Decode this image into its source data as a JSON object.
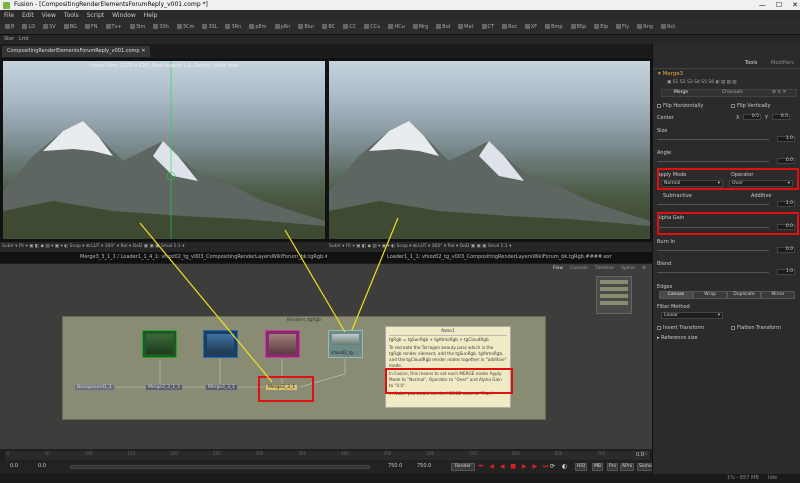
{
  "window": {
    "title": "Fusion - [CompositingRenderElementsForumReply_v001.comp *]",
    "controls": [
      "—",
      "☐",
      "✕"
    ]
  },
  "menu": [
    "File",
    "Edit",
    "View",
    "Tools",
    "Script",
    "Window",
    "Help"
  ],
  "toolbar": [
    "B",
    "LD",
    "SV",
    "BG",
    "FN",
    "Tx+",
    "3Im",
    "3Sh",
    "3Cm",
    "3SL",
    "3Rn",
    "pEm",
    "pRn",
    "Blur",
    "BC",
    "CC",
    "CCu",
    "HCu",
    "Mrg",
    "Bol",
    "Mat",
    "CT",
    "Rsz",
    "XF",
    "Bmp",
    "BSp",
    "Elp",
    "Fly",
    "Rng",
    "Rct"
  ],
  "toolbar2": [
    "Star",
    "Lmt"
  ],
  "comp_tab": "CompositingRenderElementsForumReply_v001.comp",
  "viewer_left": {
    "info": "Frame Size: 1103 x 620, Pixel Aspect 1:1, Depth: 16bit float",
    "toolbar": "SubV ▾  Fit ▾  ▣ ◧  ◆  ▤  ▾ ▣ ▾ ◐ Snap ▾  ⊞  LUT ▾  360° ▾ RoI ▾ DoD  ▣ ▣ ▣ Smal 1:1 ▾",
    "label": "Merge3_3_1_1 / Loader1_1_4_1: vfxoz02_tg_v003_CompositingRenderLayersWikiForum_bk.tgRgb.####.exr"
  },
  "viewer_right": {
    "toolbar": "SubV ▾  Fit ▾  ▣ ◧  ◆  ▤  ▾ ▣ ▾ ◐ Snap ▾  ⊞  LUT ▾  360° ▾ RoI ▾ DoD  ▣ ▣ ▣ Smal 1:1 ▾",
    "label": "Loader1_1_1: vfxoz02_tg_v003_CompositingRenderLayersWikiForum_bk.tgRgb.####.exr"
  },
  "flow": {
    "tabs": [
      "Flow",
      "Console",
      "Timeline",
      "Spline"
    ],
    "group_title": "Renders_tgRgb",
    "nodes": [
      {
        "label": "Background1_1",
        "color": "#6b6f78"
      },
      {
        "label": "Merge3_3_1_1",
        "color": "#5a5f68"
      },
      {
        "label": "Merge3_3_1",
        "color": "#5a5f68"
      },
      {
        "label": "Merge3_3_1",
        "color": "#5a5f68"
      }
    ],
    "loader_label": "vfxoz02_tg...",
    "note": {
      "title": "Note1",
      "lines": [
        "tgRgb = tgSunRgb + tgAtmoRgb + tgCloudRgb",
        "To recreate the Terragen beauty pass which is the tgRgb render element, add the tgSunRgb, tgAtmoRgb, and the tgCloudRgb render nodes together in \"additive\" mode.",
        "In Fusion, this means to set each MERGE nodes Apply Mode to \"Normal\", Operator to \"Over\" and Alpha Gain to \"0.0\".",
        "In Nuke, you would set the MERGE node to \"Plus\"."
      ]
    }
  },
  "timeline": {
    "ticks": [
      "0",
      "50",
      "100",
      "150",
      "200",
      "250",
      "300",
      "350",
      "400",
      "450",
      "500",
      "550",
      "600",
      "650",
      "700",
      "750"
    ],
    "start": "0.0",
    "render_start": "0.0",
    "render_end": "750.0",
    "end": "750.0",
    "end_right": "0.0",
    "render_btn": "Render",
    "buttons": [
      "HiQ",
      "MB",
      "Prx",
      "APrx",
      "Some"
    ]
  },
  "status": {
    "memory": "1% - 857 MB",
    "state": "Idle"
  },
  "inspector": {
    "tabs": [
      "Tools",
      "Modifiers"
    ],
    "node_name": "Merge3",
    "subtabs": [
      "Merge",
      "Channels"
    ],
    "flip_h": "Flip Horizontally",
    "flip_v": "Flip Vertically",
    "center_label": "Center",
    "center_x": "0.5",
    "center_y": "0.5",
    "size_label": "Size",
    "size_value": "1.0",
    "angle_label": "Angle",
    "angle_value": "0.0",
    "apply_mode_label": "Apply Mode",
    "apply_mode_value": "Normal",
    "operator_label": "Operator",
    "operator_value": "Over",
    "subtractive_label": "Subtractive",
    "additive_label": "Additive",
    "additive_value": "1.0",
    "alpha_gain_label": "Alpha Gain",
    "alpha_gain_value": "0.0",
    "burn_in_label": "Burn In",
    "burn_in_value": "0.0",
    "blend_label": "Blend",
    "blend_value": "1.0",
    "edges_label": "Edges",
    "edges_options": [
      "Canvas",
      "Wrap",
      "Duplicate",
      "Mirror"
    ],
    "filter_label": "Filter Method",
    "filter_value": "Linear",
    "invert_transform": "Invert Transform",
    "flatten_transform": "Flatten Transform",
    "reference_size": "Reference size"
  },
  "colors": {
    "highlight": "#e01010",
    "annotation_line": "#f0e020",
    "note_bg": "#f1ebc5",
    "group_bg": "#8a8b73"
  }
}
